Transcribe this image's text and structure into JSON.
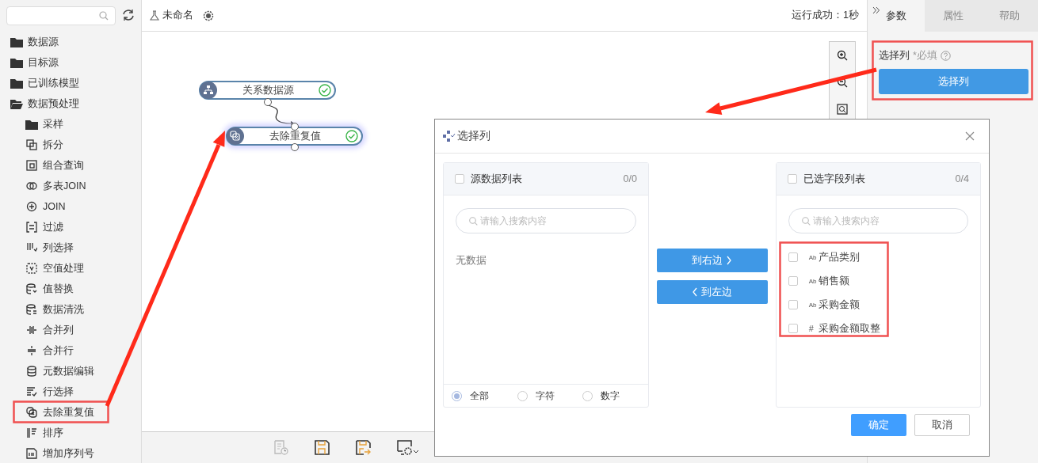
{
  "sidebar": {
    "tree": [
      {
        "label": "数据源",
        "kind": "folder",
        "expanded": false
      },
      {
        "label": "目标源",
        "kind": "folder",
        "expanded": false
      },
      {
        "label": "已训练模型",
        "kind": "folder",
        "expanded": false
      },
      {
        "label": "数据预处理",
        "kind": "folder",
        "expanded": true,
        "children": [
          {
            "label": "采样",
            "kind": "folder",
            "expanded": false
          },
          {
            "label": "拆分",
            "kind": "tool"
          },
          {
            "label": "组合查询",
            "kind": "tool"
          },
          {
            "label": "多表JOIN",
            "kind": "tool"
          },
          {
            "label": "JOIN",
            "kind": "tool"
          },
          {
            "label": "过滤",
            "kind": "tool"
          },
          {
            "label": "列选择",
            "kind": "tool"
          },
          {
            "label": "空值处理",
            "kind": "tool"
          },
          {
            "label": "值替换",
            "kind": "tool"
          },
          {
            "label": "数据清洗",
            "kind": "tool"
          },
          {
            "label": "合并列",
            "kind": "tool"
          },
          {
            "label": "合并行",
            "kind": "tool"
          },
          {
            "label": "元数据编辑",
            "kind": "tool"
          },
          {
            "label": "行选择",
            "kind": "tool"
          },
          {
            "label": "去除重复值",
            "kind": "tool"
          },
          {
            "label": "排序",
            "kind": "tool"
          },
          {
            "label": "增加序列号",
            "kind": "tool"
          }
        ]
      }
    ]
  },
  "header": {
    "title": "未命名",
    "status": "运行成功：1秒"
  },
  "canvas": {
    "nodes": [
      {
        "label": "关系数据源",
        "succeeded": true,
        "selected": false
      },
      {
        "label": "去除重复值",
        "succeeded": true,
        "selected": true
      }
    ]
  },
  "bottom_toolbar": [
    {
      "kind": "history",
      "disabled": true
    },
    {
      "kind": "save",
      "disabled": false
    },
    {
      "kind": "save-as",
      "disabled": false
    },
    {
      "kind": "settings",
      "disabled": false
    }
  ],
  "panel": {
    "tabs": [
      {
        "label": "参数",
        "selected": true
      },
      {
        "label": "属性",
        "selected": false
      },
      {
        "label": "帮助",
        "selected": false
      }
    ],
    "field": {
      "label": "选择列",
      "required": "*必填",
      "button": "选择列"
    }
  },
  "dialog": {
    "title": "选择列",
    "source": {
      "title": "源数据列表",
      "checked": false,
      "count": "0/0",
      "placeholder": "请输入搜索内容",
      "empty": "无数据",
      "filters": [
        {
          "label": "全部",
          "selected": true
        },
        {
          "label": "字符",
          "selected": false
        },
        {
          "label": "数字",
          "selected": false
        }
      ]
    },
    "moves": [
      "到右边",
      "到左边"
    ],
    "target": {
      "title": "已选字段列表",
      "checked": false,
      "count": "0/4",
      "placeholder": "请输入搜索内容",
      "items": [
        {
          "kind": "string",
          "mark": "Ab",
          "label": "产品类别",
          "checked": false
        },
        {
          "kind": "string",
          "mark": "Ab",
          "label": "销售额",
          "checked": false
        },
        {
          "kind": "string",
          "mark": "Ab",
          "label": "采购金额",
          "checked": false
        },
        {
          "kind": "number",
          "mark": "#",
          "label": "采购金额取整",
          "checked": false
        }
      ]
    },
    "buttons": [
      "确定",
      "取消"
    ]
  }
}
